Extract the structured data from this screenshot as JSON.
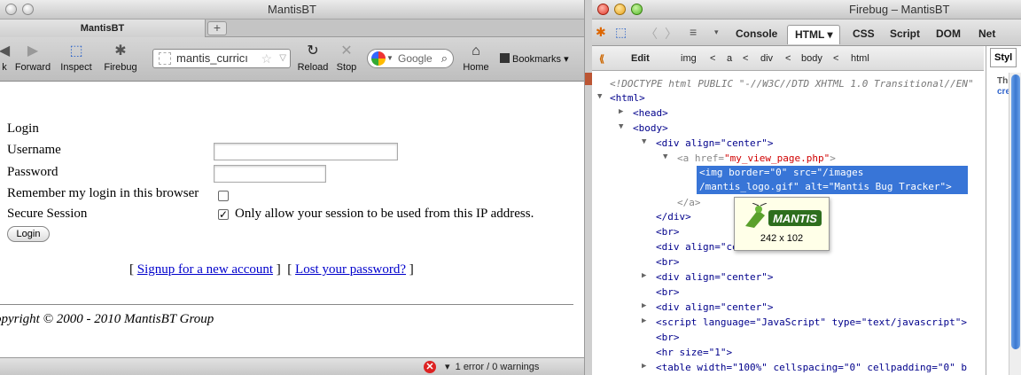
{
  "browser": {
    "window_title": "MantisBT",
    "tab_title": "MantisBT",
    "new_tab": "+",
    "nav": {
      "back": "k",
      "forward": "Forward",
      "inspect": "Inspect",
      "firebug": "Firebug",
      "reload": "Reload",
      "stop": "Stop",
      "home": "Home"
    },
    "url": "mantis_curricı",
    "search_engine": "Google",
    "bookmarks": "Bookmarks",
    "page": {
      "login_heading": "Login",
      "username_label": "Username",
      "password_label": "Password",
      "remember_label": "Remember my login in this browser",
      "secure_label": "Secure Session",
      "secure_text": "Only allow your session to be used from this IP address.",
      "remember_checked": false,
      "secure_checked": true,
      "login_button": "Login",
      "bracket_open": "[",
      "bracket_close": "]",
      "signup_link": "Signup for a new account",
      "lost_password_link": "Lost your password?",
      "copyright": "opyright © 2000 - 2010 MantisBT Group"
    },
    "status": {
      "errors": "1 error / 0 warnings"
    }
  },
  "firebug": {
    "window_title": "Firebug – MantisBT",
    "tabs": [
      "Console",
      "HTML ▾",
      "CSS",
      "Script",
      "DOM",
      "Net"
    ],
    "active_tab": "HTML",
    "edit_button": "Edit",
    "breadcrumb": [
      "img",
      "<",
      "a",
      "<",
      "div",
      "<",
      "body",
      "<",
      "html"
    ],
    "side_tab": "Styl",
    "side_hint_1": "This",
    "side_hint_2": "crea",
    "tree": {
      "doctype": "<!DOCTYPE html PUBLIC \"-//W3C//DTD XHTML 1.0 Transitional//EN\"",
      "html": "<html>",
      "head": "<head>",
      "body": "<body>",
      "div_center_1": "<div align=\"center\">",
      "a_href_tag": "<a href=",
      "a_href_val": "\"my_view_page.php\"",
      "a_href_end": ">",
      "img_line1": "<img border=\"0\" src=\"/images",
      "img_line2": "/mantis_logo.gif\" alt=\"Mantis Bug Tracker\">",
      "a_close": "</a>",
      "div_close": "</div>",
      "br1": "<br>",
      "div_align_partial": "<div align=\"ce",
      "br2": "<br>",
      "div_center_2": "<div align=\"center\">",
      "br3": "<br>",
      "div_center_3": "<div align=\"center\">",
      "script_tag": "<script language=\"JavaScript\" type=\"text/javascript\">",
      "br4": "<br>",
      "hr_tag": "<hr size=\"1\">",
      "table_tag": "<table width=\"100%\" cellspacing=\"0\" cellpadding=\"0\" b"
    },
    "tooltip": {
      "logo_text": "MANTIS",
      "dimensions": "242 x 102"
    }
  }
}
